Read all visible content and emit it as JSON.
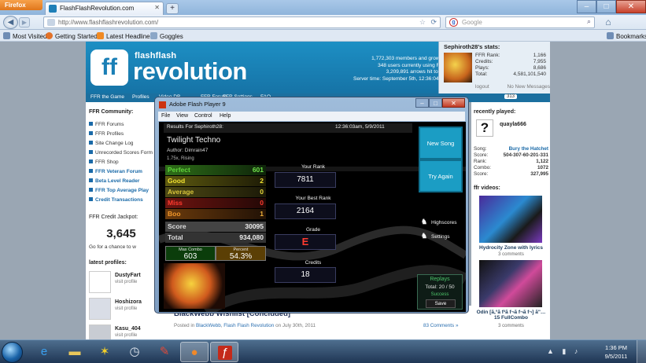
{
  "browser": {
    "menu_button": "Firefox",
    "tab_title": "FlashFlashRevolution.com",
    "url": "http://www.flashflashrevolution.com/",
    "search_placeholder": "Google",
    "bookmarks": [
      "Most Visited",
      "Getting Started",
      "Latest Headlines",
      "Goggles"
    ],
    "bookmarks_menu": "Bookmarks"
  },
  "site": {
    "logo_small": "flashflash",
    "logo_big": "revolution",
    "logo_mark": "ff",
    "stats_lines": [
      "1,772,303 members and growing!",
      "348 users currently using FFR.",
      "3,209,891 arrows hit today!",
      "Server time: September 5th, 12:36:04 PM"
    ],
    "nav": [
      "FFR the Game",
      "Profiles",
      "Video DB",
      "FFR Forum",
      "FFR Settings",
      "FAQ"
    ],
    "nav_count": "313"
  },
  "user_stats": {
    "title": "Sephiroth28's stats:",
    "rows": [
      {
        "label": "FFR Rank:",
        "value": "1,166"
      },
      {
        "label": "Credits:",
        "value": "7,955"
      },
      {
        "label": "Plays:",
        "value": "8,686"
      },
      {
        "label": "Total:",
        "value": "4,581,101,540"
      }
    ],
    "logout": "logout",
    "messages": "No New Messages"
  },
  "left_col": {
    "community_title": "FFR Community:",
    "links": [
      "FFR Forums",
      "FFR Profiles",
      "Site Change Log",
      "Unrecorded Scores Form",
      "FFR Shop"
    ],
    "bold_links": [
      "FFR Veteran Forum",
      "Beta Level Reader",
      "FFR Top Average Play",
      "Credit Transactions"
    ],
    "jackpot_title": "FFR Credit Jackpot:",
    "jackpot_value": "3,645",
    "jackpot_note": "Go for a chance to w",
    "latest_title": "latest profiles:",
    "profiles": [
      {
        "name": "DustyFart",
        "sub": "visit profile"
      },
      {
        "name": "Hoshizora",
        "sub": "visit profile"
      },
      {
        "name": "Kasu_404",
        "sub": "visit profile"
      }
    ]
  },
  "right_col": {
    "recent_title": "recently played:",
    "recent_user": "quayla666",
    "rows": [
      {
        "label": "Song:",
        "value": "Bury the Hatchet"
      },
      {
        "label": "Score:",
        "value": "504-307-60-201-331"
      },
      {
        "label": "Rank:",
        "value": "1,122"
      },
      {
        "label": "Combo:",
        "value": "1072"
      },
      {
        "label": "Score:",
        "value": "327,995"
      }
    ],
    "videos_title": "ffr videos:",
    "videos": [
      {
        "title": "Hydrocity Zone with lyrics",
        "sub": "3 comments"
      },
      {
        "title": "Odin [ã,°ã f³ã f¬ã f¬ã f¬] ã\"…15 FullCombo",
        "sub": "3 comments"
      }
    ]
  },
  "post": {
    "title": "BlackWebb Wishlist [Concluded]",
    "meta_prefix": "Posted in",
    "meta_author": "BlackWebb",
    "meta_sep": ",",
    "meta_site": "Flash Flash Revolution",
    "meta_date": "on July 30th, 2011",
    "comments": "83 Comments »"
  },
  "flash": {
    "title": "Adobe Flash Player 9",
    "menu": [
      "File",
      "View",
      "Control",
      "Help"
    ]
  },
  "game": {
    "results_for": "Results For Sephiroth28:",
    "datetime": "12:36:03am, 5/9/2011",
    "song": "Twilight Techno",
    "author": "Author: Dimrain47",
    "speed": "1.75x, Rising",
    "judgements": [
      {
        "label": "Perfect",
        "value": "601",
        "color": "#4fbf2c"
      },
      {
        "label": "Good",
        "value": "2",
        "color": "#e2d22a"
      },
      {
        "label": "Average",
        "value": "0",
        "color": "#d8c43a"
      },
      {
        "label": "Miss",
        "value": "0",
        "color": "#e8342a"
      },
      {
        "label": "Boo",
        "value": "1",
        "color": "#e0962a"
      }
    ],
    "score_label": "Score",
    "score_value": "30095",
    "total_label": "Total",
    "total_value": "934,080",
    "maxcombo_label": "Max Combo",
    "maxcombo_value": "603",
    "percent_label": "Percent",
    "percent_value": "54.3%",
    "your_rank_label": "Your Rank",
    "your_rank_value": "7811",
    "best_rank_label": "Your Best Rank",
    "best_rank_value": "2164",
    "grade_label": "Grade",
    "grade_value": "E",
    "credits_label": "Credits",
    "credits_value": "18",
    "new_song": "New Song",
    "try_again": "Try Again",
    "highscores": "Highscores",
    "settings": "Settings",
    "replays_title": "Replays",
    "replays_total": "Total: 20 / 50",
    "replays_status": "Success",
    "save": "Save"
  },
  "taskbar": {
    "time": "1:36 PM",
    "date": "9/5/2011"
  }
}
